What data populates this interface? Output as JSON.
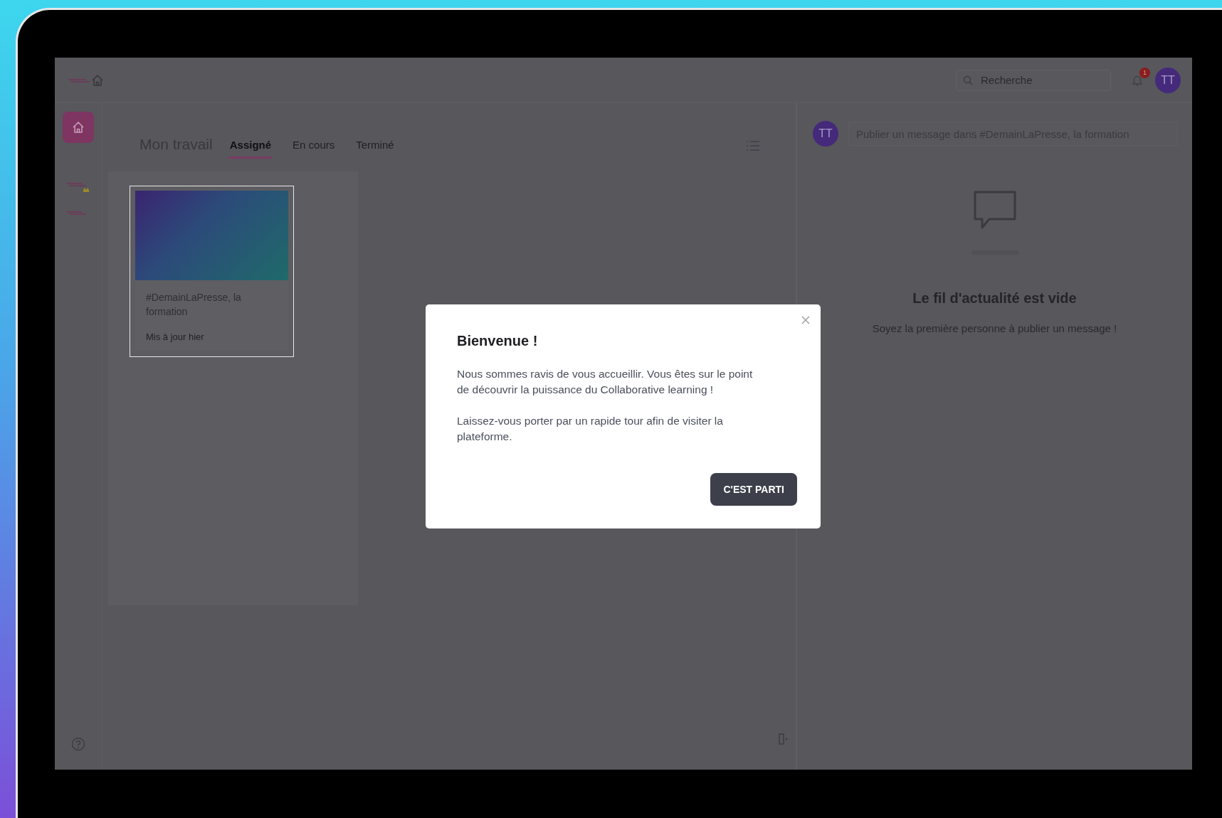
{
  "topbar": {
    "search": {
      "placeholder": "Recherche"
    },
    "notifications": {
      "count": "1"
    },
    "avatar": "TT"
  },
  "work": {
    "title": "Mon travail",
    "tabs": [
      {
        "label": "Assigné",
        "selected": true
      },
      {
        "label": "En cours",
        "selected": false
      },
      {
        "label": "Terminé",
        "selected": false
      }
    ],
    "cards": [
      {
        "title": "#DemainLaPresse, la formation",
        "updated": "Mis à jour hier",
        "highlighted": true
      }
    ]
  },
  "feed": {
    "avatar": "TT",
    "composer": {
      "placeholder": "Publier un message dans #DemainLaPresse, la formation"
    },
    "empty_title": "Le fil d'actualité est vide",
    "empty_text": "Soyez la première personne à publier un message !"
  },
  "dialog": {
    "title": "Bienvenue !",
    "paragraphs": [
      "Nous sommes ravis de vous accueillir. Vous êtes sur le point de découvrir la puissance du Collaborative learning !",
      "Laissez-vous porter par un rapide tour afin de visiter la plateforme."
    ],
    "button": "C'EST PARTI"
  }
}
